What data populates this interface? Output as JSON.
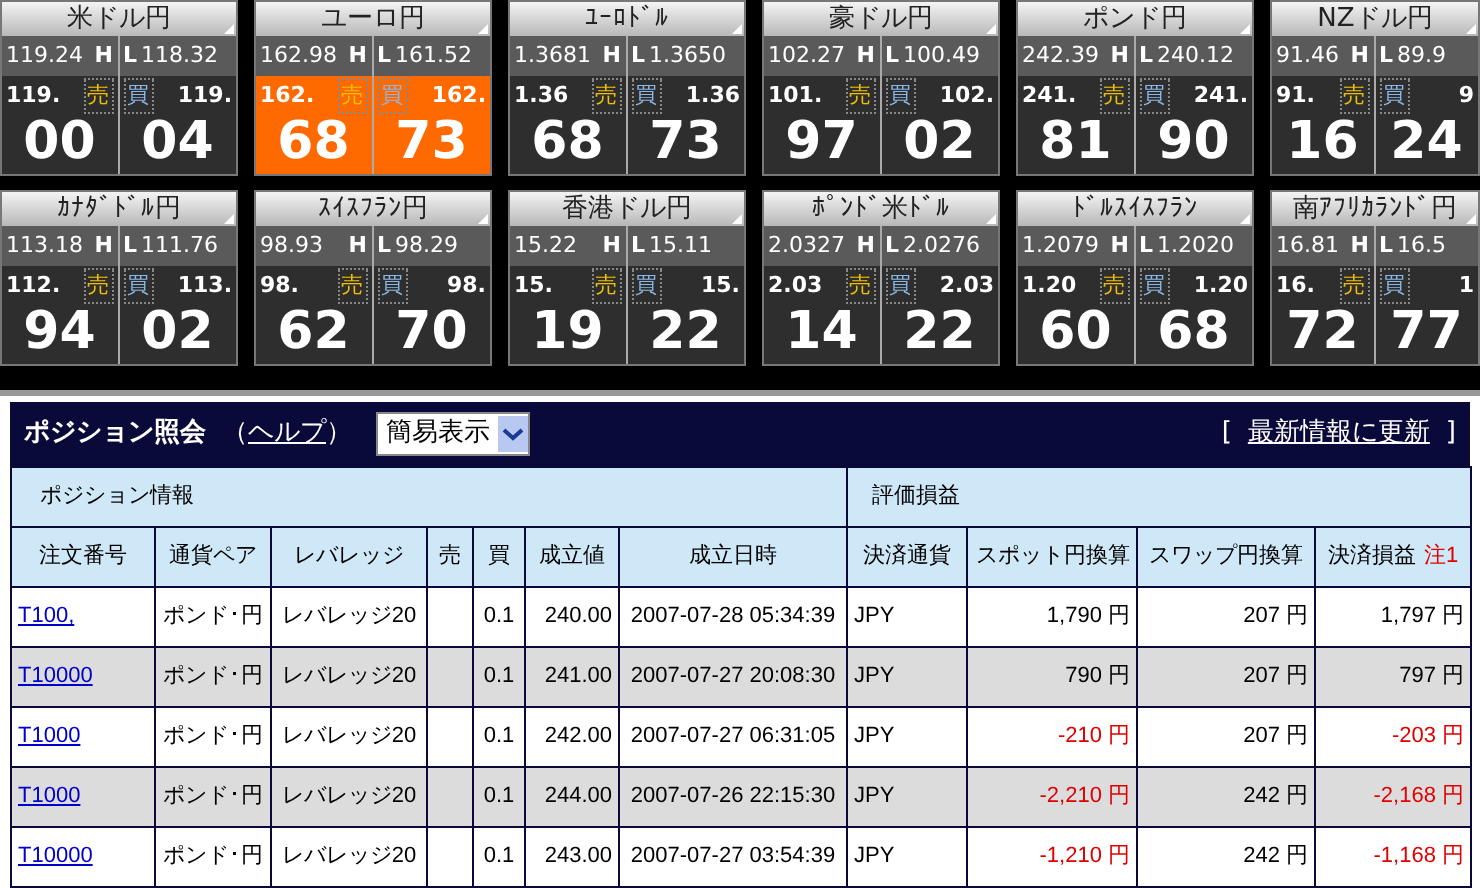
{
  "tiles": [
    {
      "name": "米ドル円",
      "high": "119.24",
      "h_label": "H",
      "l_label": "L",
      "low": "118.32",
      "bid": "119.",
      "sell_label": "売",
      "buy_label": "買",
      "ask": "119.",
      "bid_big": "00",
      "ask_big": "04",
      "highlighted": false
    },
    {
      "name": "ユーロ円",
      "high": "162.98",
      "h_label": "H",
      "l_label": "L",
      "low": "161.52",
      "bid": "162.",
      "sell_label": "売",
      "buy_label": "買",
      "ask": "162.",
      "bid_big": "68",
      "ask_big": "73",
      "highlighted": true
    },
    {
      "name": "ﾕｰﾛﾄﾞﾙ",
      "high": "1.3681",
      "h_label": "H",
      "l_label": "L",
      "low": "1.3650",
      "bid": "1.36",
      "sell_label": "売",
      "buy_label": "買",
      "ask": "1.36",
      "bid_big": "68",
      "ask_big": "73",
      "highlighted": false
    },
    {
      "name": "豪ドル円",
      "high": "102.27",
      "h_label": "H",
      "l_label": "L",
      "low": "100.49",
      "bid": "101.",
      "sell_label": "売",
      "buy_label": "買",
      "ask": "102.",
      "bid_big": "97",
      "ask_big": "02",
      "highlighted": false
    },
    {
      "name": "ポンド円",
      "high": "242.39",
      "h_label": "H",
      "l_label": "L",
      "low": "240.12",
      "bid": "241.",
      "sell_label": "売",
      "buy_label": "買",
      "ask": "241.",
      "bid_big": "81",
      "ask_big": "90",
      "highlighted": false
    },
    {
      "name": "NZドル円",
      "high": "91.46",
      "h_label": "H",
      "l_label": "L",
      "low": "89.9",
      "bid": "91.",
      "sell_label": "売",
      "buy_label": "買",
      "ask": "9",
      "bid_big": "16",
      "ask_big": "24",
      "highlighted": false
    },
    {
      "name": "ｶﾅﾀﾞﾄﾞﾙ円",
      "high": "113.18",
      "h_label": "H",
      "l_label": "L",
      "low": "111.76",
      "bid": "112.",
      "sell_label": "売",
      "buy_label": "買",
      "ask": "113.",
      "bid_big": "94",
      "ask_big": "02",
      "highlighted": false
    },
    {
      "name": "ｽｲｽﾌﾗﾝ円",
      "high": "98.93",
      "h_label": "H",
      "l_label": "L",
      "low": "98.29",
      "bid": "98.",
      "sell_label": "売",
      "buy_label": "買",
      "ask": "98.",
      "bid_big": "62",
      "ask_big": "70",
      "highlighted": false
    },
    {
      "name": "香港ドル円",
      "high": "15.22",
      "h_label": "H",
      "l_label": "L",
      "low": "15.11",
      "bid": "15.",
      "sell_label": "売",
      "buy_label": "買",
      "ask": "15.",
      "bid_big": "19",
      "ask_big": "22",
      "highlighted": false
    },
    {
      "name": "ﾎﾟﾝﾄﾞ米ﾄﾞﾙ",
      "high": "2.0327",
      "h_label": "H",
      "l_label": "L",
      "low": "2.0276",
      "bid": "2.03",
      "sell_label": "売",
      "buy_label": "買",
      "ask": "2.03",
      "bid_big": "14",
      "ask_big": "22",
      "highlighted": false
    },
    {
      "name": "ﾄﾞﾙｽｲｽﾌﾗﾝ",
      "high": "1.2079",
      "h_label": "H",
      "l_label": "L",
      "low": "1.2020",
      "bid": "1.20",
      "sell_label": "売",
      "buy_label": "買",
      "ask": "1.20",
      "bid_big": "60",
      "ask_big": "68",
      "highlighted": false
    },
    {
      "name": "南ｱﾌﾘｶﾗﾝﾄﾞ円",
      "high": "16.81",
      "h_label": "H",
      "l_label": "L",
      "low": "16.5",
      "bid": "16.",
      "sell_label": "売",
      "buy_label": "買",
      "ask": "1",
      "bid_big": "72",
      "ask_big": "77",
      "highlighted": false
    }
  ],
  "panel": {
    "title": "ポジション照会",
    "help_open": "（",
    "help_link": "ヘルプ",
    "help_close": "）",
    "view_select": "簡易表示",
    "refresh_open": "[",
    "refresh_link": "最新情報に更新",
    "refresh_close": "]"
  },
  "table": {
    "group_headers": [
      "ポジション情報",
      "評価損益"
    ],
    "columns": [
      "注文番号",
      "通貨ペア",
      "レバレッジ",
      "売",
      "買",
      "成立値",
      "成立日時",
      "決済通貨",
      "スポット円換算",
      "スワップ円換算",
      "決済損益"
    ],
    "note": "注1",
    "rows": [
      {
        "order": "T100,",
        "pair": "ポンド･円",
        "leverage": "レバレッジ20",
        "sell": "",
        "buy": "0.1",
        "price": "240.00",
        "datetime": "2007-07-28 05:34:39",
        "currency": "JPY",
        "spot": "1,790 円",
        "spot_negative": false,
        "swap": "207 円",
        "pnl": "1,797 円",
        "pnl_negative": false
      },
      {
        "order": "T10000",
        "pair": "ポンド･円",
        "leverage": "レバレッジ20",
        "sell": "",
        "buy": "0.1",
        "price": "241.00",
        "datetime": "2007-07-27 20:08:30",
        "currency": "JPY",
        "spot": "790 円",
        "spot_negative": false,
        "swap": "207 円",
        "pnl": "797 円",
        "pnl_negative": false
      },
      {
        "order": "T1000",
        "pair": "ポンド･円",
        "leverage": "レバレッジ20",
        "sell": "",
        "buy": "0.1",
        "price": "242.00",
        "datetime": "2007-07-27 06:31:05",
        "currency": "JPY",
        "spot": "-210 円",
        "spot_negative": true,
        "swap": "207 円",
        "pnl": "-203 円",
        "pnl_negative": true
      },
      {
        "order": "T1000",
        "pair": "ポンド･円",
        "leverage": "レバレッジ20",
        "sell": "",
        "buy": "0.1",
        "price": "244.00",
        "datetime": "2007-07-26 22:15:30",
        "currency": "JPY",
        "spot": "-2,210 円",
        "spot_negative": true,
        "swap": "242 円",
        "pnl": "-2,168 円",
        "pnl_negative": true
      },
      {
        "order": "T10000",
        "pair": "ポンド･円",
        "leverage": "レバレッジ20",
        "sell": "",
        "buy": "0.1",
        "price": "243.00",
        "datetime": "2007-07-27 03:54:39",
        "currency": "JPY",
        "spot": "-1,210 円",
        "spot_negative": true,
        "swap": "242 円",
        "pnl": "-1,168 円",
        "pnl_negative": true
      }
    ]
  }
}
